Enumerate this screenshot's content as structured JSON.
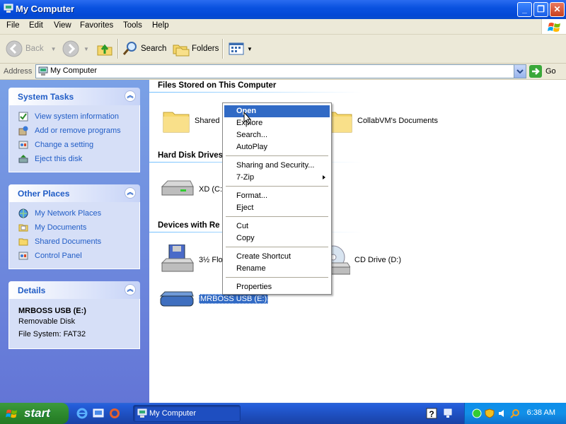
{
  "window": {
    "title": "My Computer"
  },
  "menubar": [
    "File",
    "Edit",
    "View",
    "Favorites",
    "Tools",
    "Help"
  ],
  "toolbar": {
    "back": "Back",
    "search": "Search",
    "folders": "Folders"
  },
  "address": {
    "label": "Address",
    "value": "My Computer",
    "go": "Go"
  },
  "taskpane": {
    "system_tasks": {
      "title": "System Tasks",
      "items": [
        "View system information",
        "Add or remove programs",
        "Change a setting",
        "Eject this disk"
      ]
    },
    "other_places": {
      "title": "Other Places",
      "items": [
        "My Network Places",
        "My Documents",
        "Shared Documents",
        "Control Panel"
      ]
    },
    "details": {
      "title": "Details",
      "name": "MRBOSS USB (E:)",
      "type": "Removable Disk",
      "filesystem": "File System: FAT32"
    }
  },
  "main": {
    "groups": {
      "files": "Files Stored on This Computer",
      "hdd": "Hard Disk Drives",
      "devices": "Devices with Re"
    },
    "items": {
      "shared": "Shared",
      "collab": "CollabVM's Documents",
      "xd": "XD (C:)",
      "floppy": "3½ Flop",
      "cd": "CD Drive (D:)",
      "usb": "MRBOSS USB (E:)"
    }
  },
  "context_menu": {
    "items": [
      "Open",
      "Explore",
      "Search...",
      "AutoPlay",
      "Sharing and Security...",
      "7-Zip",
      "Format...",
      "Eject",
      "Cut",
      "Copy",
      "Create Shortcut",
      "Rename",
      "Properties"
    ],
    "highlighted": "Open"
  },
  "taskbar": {
    "start": "start",
    "task": "My Computer",
    "clock": "6:38 AM"
  },
  "colors": {
    "title_blue": "#0448d6",
    "taskpane_blue": "#6375d6",
    "highlight": "#316ac5",
    "start_green": "#2e8a2e"
  }
}
